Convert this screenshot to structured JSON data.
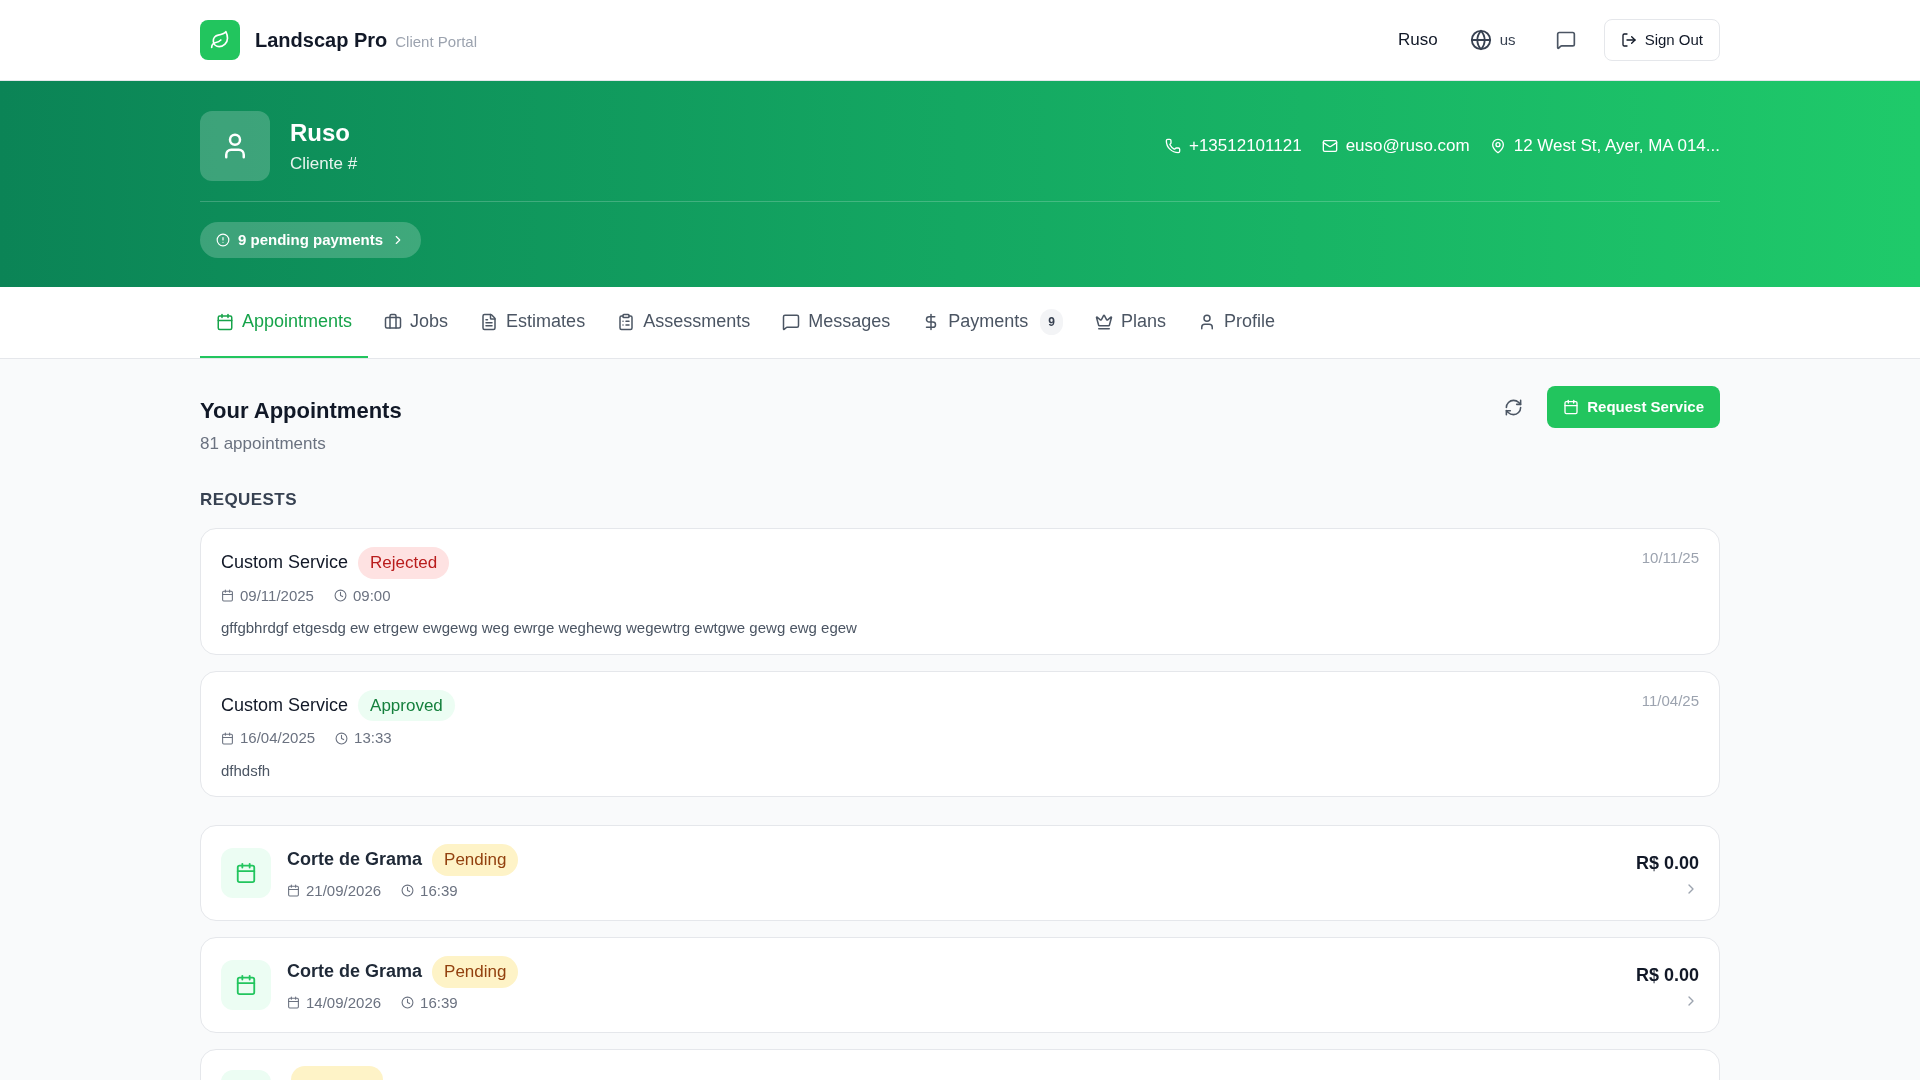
{
  "header": {
    "brand": "Landscap Pro",
    "subtitle": "Client Portal",
    "user": "Ruso",
    "language": "us",
    "sign_out": "Sign Out"
  },
  "client": {
    "name": "Ruso",
    "number": "Cliente #",
    "phone": "+13512101121",
    "email": "euso@ruso.com",
    "address": "12 West St, Ayer, MA 014...",
    "pending": "9 pending payments"
  },
  "tabs": [
    {
      "label": "Appointments",
      "selected": true
    },
    {
      "label": "Jobs",
      "selected": false
    },
    {
      "label": "Estimates",
      "selected": false
    },
    {
      "label": "Assessments",
      "selected": false
    },
    {
      "label": "Messages",
      "selected": false
    },
    {
      "label": "Payments",
      "selected": false,
      "badge": "9"
    },
    {
      "label": "Plans",
      "selected": false
    },
    {
      "label": "Profile",
      "selected": false
    }
  ],
  "section": {
    "title": "Your Appointments",
    "count": "81 appointments",
    "request_button": "Request Service",
    "requests_label": "REQUESTS"
  },
  "requests": [
    {
      "title": "Custom Service",
      "kind": "rejected",
      "status_label": "Rejected",
      "date": "09/11/2025",
      "time": "09:00",
      "note": "gffgbhrdgf etgesdg ew etrgew ewgewg weg ewrge weghewg wegewtrg ewtgwe gewg ewg egew",
      "created": "10/11/25"
    },
    {
      "title": "Custom Service",
      "kind": "approved",
      "status_label": "Approved",
      "date": "16/04/2025",
      "time": "13:33",
      "note": "dfhdsfh",
      "created": "11/04/25"
    }
  ],
  "appointments": [
    {
      "title": "Corte de Grama",
      "kind": "pending",
      "cut": false,
      "status_label": "Pending",
      "date": "21/09/2026",
      "time": "16:39",
      "price": "R$ 0.00"
    },
    {
      "title": "Corte de Grama",
      "kind": "pending",
      "cut": false,
      "status_label": "Pending",
      "date": "14/09/2026",
      "time": "16:39",
      "price": "R$ 0.00"
    },
    {
      "kind": "pending",
      "cut": true
    }
  ]
}
